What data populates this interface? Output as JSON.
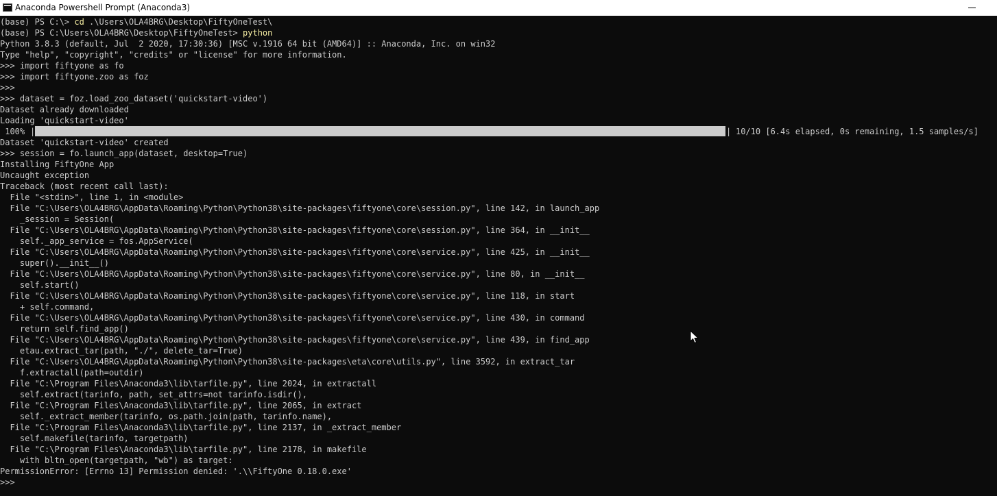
{
  "window": {
    "title": "Anaconda Powershell Prompt (Anaconda3)"
  },
  "colors": {
    "background": "#0c0c0c",
    "text": "#cccccc",
    "command_highlight": "#f9f1a5",
    "titlebar": "#ffffff"
  },
  "icons": {
    "app": "console-app-icon",
    "minimize": "minimize-icon",
    "cursor": "mouse-pointer-icon"
  },
  "console": {
    "lines_before_progress": [
      {
        "text": "(base) PS C:\\> ",
        "cmd": "cd",
        "rest": " .\\Users\\OLA4BRG\\Desktop\\FiftyOneTest\\"
      },
      {
        "text": "(base) PS C:\\Users\\OLA4BRG\\Desktop\\FiftyOneTest> ",
        "cmd": "python",
        "rest": ""
      },
      {
        "text": "Python 3.8.3 (default, Jul  2 2020, 17:30:36) [MSC v.1916 64 bit (AMD64)] :: Anaconda, Inc. on win32"
      },
      {
        "text": "Type \"help\", \"copyright\", \"credits\" or \"license\" for more information."
      },
      {
        "text": ">>> import fiftyone as fo"
      },
      {
        "text": ">>> import fiftyone.zoo as foz"
      },
      {
        "text": ">>>"
      },
      {
        "text": ">>> dataset = foz.load_zoo_dataset('quickstart-video')"
      },
      {
        "text": "Dataset already downloaded"
      },
      {
        "text": "Loading 'quickstart-video'"
      }
    ],
    "progress": {
      "percent_label": " 100%",
      "open": "|",
      "close": "|",
      "fraction": 1.0,
      "stats": "10/10 [6.4s elapsed, 0s remaining, 1.5 samples/s]"
    },
    "lines_after_progress": [
      "Dataset 'quickstart-video' created",
      ">>> session = fo.launch_app(dataset, desktop=True)",
      "Installing FiftyOne App",
      "Uncaught exception",
      "Traceback (most recent call last):",
      "  File \"<stdin>\", line 1, in <module>",
      "  File \"C:\\Users\\OLA4BRG\\AppData\\Roaming\\Python\\Python38\\site-packages\\fiftyone\\core\\session.py\", line 142, in launch_app",
      "    _session = Session(",
      "  File \"C:\\Users\\OLA4BRG\\AppData\\Roaming\\Python\\Python38\\site-packages\\fiftyone\\core\\session.py\", line 364, in __init__",
      "    self._app_service = fos.AppService(",
      "  File \"C:\\Users\\OLA4BRG\\AppData\\Roaming\\Python\\Python38\\site-packages\\fiftyone\\core\\service.py\", line 425, in __init__",
      "    super().__init__()",
      "  File \"C:\\Users\\OLA4BRG\\AppData\\Roaming\\Python\\Python38\\site-packages\\fiftyone\\core\\service.py\", line 80, in __init__",
      "    self.start()",
      "  File \"C:\\Users\\OLA4BRG\\AppData\\Roaming\\Python\\Python38\\site-packages\\fiftyone\\core\\service.py\", line 118, in start",
      "    + self.command,",
      "  File \"C:\\Users\\OLA4BRG\\AppData\\Roaming\\Python\\Python38\\site-packages\\fiftyone\\core\\service.py\", line 430, in command",
      "    return self.find_app()",
      "  File \"C:\\Users\\OLA4BRG\\AppData\\Roaming\\Python\\Python38\\site-packages\\fiftyone\\core\\service.py\", line 439, in find_app",
      "    etau.extract_tar(path, \"./\", delete_tar=True)",
      "  File \"C:\\Users\\OLA4BRG\\AppData\\Roaming\\Python\\Python38\\site-packages\\eta\\core\\utils.py\", line 3592, in extract_tar",
      "    f.extractall(path=outdir)",
      "  File \"C:\\Program Files\\Anaconda3\\lib\\tarfile.py\", line 2024, in extractall",
      "    self.extract(tarinfo, path, set_attrs=not tarinfo.isdir(),",
      "  File \"C:\\Program Files\\Anaconda3\\lib\\tarfile.py\", line 2065, in extract",
      "    self._extract_member(tarinfo, os.path.join(path, tarinfo.name),",
      "  File \"C:\\Program Files\\Anaconda3\\lib\\tarfile.py\", line 2137, in _extract_member",
      "    self.makefile(tarinfo, targetpath)",
      "  File \"C:\\Program Files\\Anaconda3\\lib\\tarfile.py\", line 2178, in makefile",
      "    with bltn_open(targetpath, \"wb\") as target:",
      "PermissionError: [Errno 13] Permission denied: '.\\\\FiftyOne 0.18.0.exe'",
      ">>>"
    ]
  }
}
